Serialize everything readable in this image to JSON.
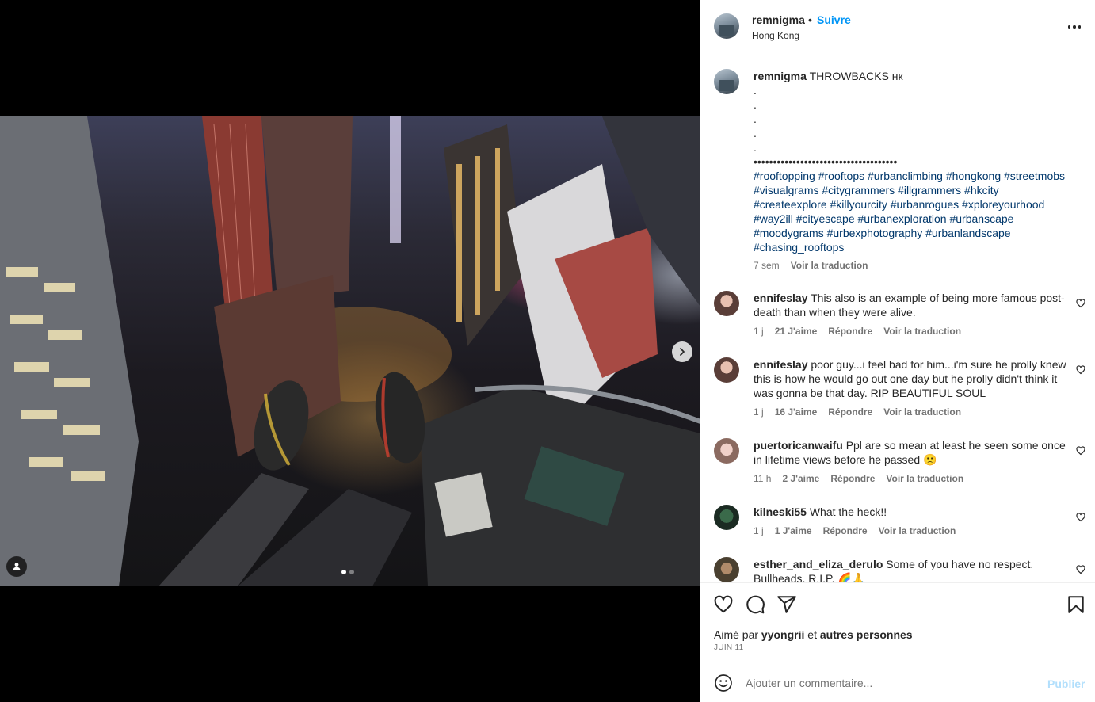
{
  "post": {
    "author": "remnigma",
    "separator": "•",
    "follow_label": "Suivre",
    "location": "Hong Kong"
  },
  "caption": {
    "username": "remnigma",
    "title": "THROWBACKS нк",
    "dot_lines": [
      ".",
      ".",
      ".",
      ".",
      "."
    ],
    "bullet_line": "•••••••••••••••••••••••••••••••••••••",
    "hashtags": "#rooftopping #rooftops #urbanclimbing #hongkong #streetmobs #visualgrams #citygrammers #illgrammers #hkcity #createexplore #killyourcity #urbanrogues #xploreyourhood #way2ill #cityescape #urbanexploration #urbanscape #moodygrams #urbexphotography #urbanlandscape #chasing_rooftops",
    "time": "7 sem",
    "translate": "Voir la traduction"
  },
  "comments": [
    {
      "username": "ennifeslay",
      "text": "This also is an example of being more famous post-death than when they were alive.",
      "time": "1 j",
      "likes": "21 J'aime",
      "reply": "Répondre",
      "translate": "Voir la traduction"
    },
    {
      "username": "ennifeslay",
      "text": "poor guy...i feel bad for him...i'm sure he prolly knew this is how he would go out one day but he prolly didn't think it was gonna be that day. RIP BEAUTIFUL SOUL",
      "time": "1 j",
      "likes": "16 J'aime",
      "reply": "Répondre",
      "translate": "Voir la traduction"
    },
    {
      "username": "puertoricanwaifu",
      "text": "Ppl are so mean at least he seen some once in lifetime views before he passed 🙁",
      "time": "11 h",
      "likes": "2 J'aime",
      "reply": "Répondre",
      "translate": "Voir la traduction"
    },
    {
      "username": "kilneski55",
      "text": "What the heck!!",
      "time": "1 j",
      "likes": "1 J'aime",
      "reply": "Répondre",
      "translate": "Voir la traduction"
    },
    {
      "username": "esther_and_eliza_derulo",
      "text": "Some of you have no respect. Bullheads. R.I.P. 🌈🙏",
      "time": "",
      "likes": "",
      "reply": "",
      "translate": ""
    }
  ],
  "likes": {
    "prefix": "Aimé par",
    "user": "yyongrii",
    "mid": "et",
    "others": "autres personnes"
  },
  "date": "JUIN 11",
  "composer": {
    "placeholder": "Ajouter un commentaire...",
    "publish_label": "Publier"
  },
  "carousel": {
    "slides": 2,
    "current": 1
  },
  "colors": {
    "accent": "#0095f6",
    "hashtag": "#00376b",
    "muted": "#737373",
    "publish_disabled": "#b2dffc"
  },
  "icons": [
    "chevron-right-icon",
    "user-tag-icon",
    "more-options-icon",
    "heart-icon",
    "comment-icon",
    "share-icon",
    "bookmark-icon",
    "emoji-icon"
  ]
}
